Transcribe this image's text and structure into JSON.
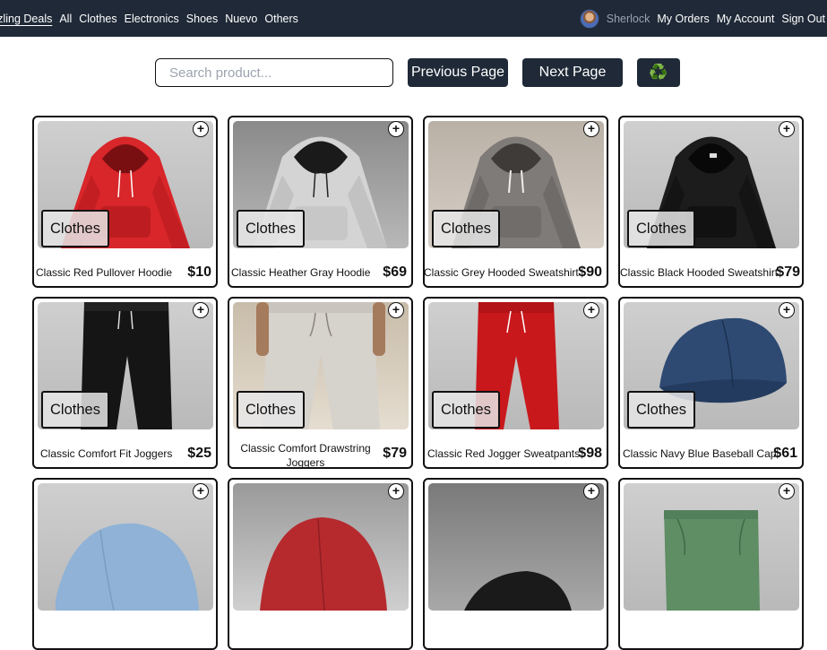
{
  "nav": {
    "brand": "azzling Deals",
    "links": [
      "All",
      "Clothes",
      "Electronics",
      "Shoes",
      "Nuevo",
      "Others"
    ],
    "user": "Sherlock",
    "account_links": [
      "My Orders",
      "My Account",
      "Sign Out"
    ]
  },
  "controls": {
    "search_placeholder": "Search product...",
    "prev_label": "Previous Page",
    "next_label": "Next Page",
    "recycle_icon": "♻️"
  },
  "products": [
    {
      "name": "Classic Red Pullover Hoodie",
      "price": "$10",
      "category": "Clothes",
      "add": "+"
    },
    {
      "name": "Classic Heather Gray Hoodie",
      "price": "$69",
      "category": "Clothes",
      "add": "+"
    },
    {
      "name": "Classic Grey Hooded Sweatshirt",
      "price": "$90",
      "category": "Clothes",
      "add": "+"
    },
    {
      "name": "Classic Black Hooded Sweatshirt",
      "price": "$79",
      "category": "Clothes",
      "add": "+"
    },
    {
      "name": "Classic Comfort Fit Joggers",
      "price": "$25",
      "category": "Clothes",
      "add": "+"
    },
    {
      "name": "Classic Comfort Drawstring Joggers",
      "price": "$79",
      "category": "Clothes",
      "add": "+"
    },
    {
      "name": "Classic Red Jogger Sweatpants",
      "price": "$98",
      "category": "Clothes",
      "add": "+"
    },
    {
      "name": "Classic Navy Blue Baseball Cap",
      "price": "$61",
      "category": "Clothes",
      "add": "+"
    },
    {
      "add": "+"
    },
    {
      "add": "+"
    },
    {
      "add": "+"
    },
    {
      "add": "+"
    }
  ]
}
